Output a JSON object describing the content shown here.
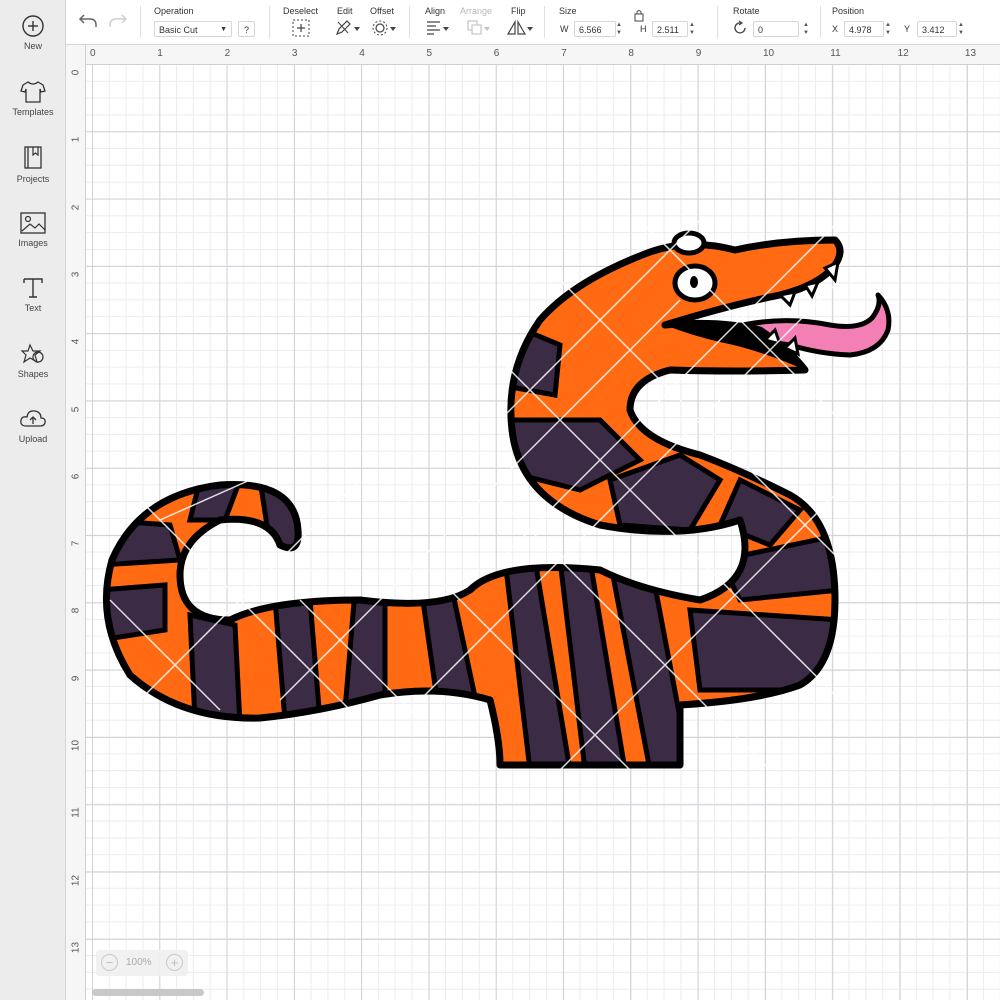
{
  "sidebar": {
    "items": [
      {
        "label": "New",
        "icon": "plus-circle-icon"
      },
      {
        "label": "Templates",
        "icon": "shirt-icon"
      },
      {
        "label": "Projects",
        "icon": "book-icon"
      },
      {
        "label": "Images",
        "icon": "image-icon"
      },
      {
        "label": "Text",
        "icon": "text-icon"
      },
      {
        "label": "Shapes",
        "icon": "shapes-icon"
      },
      {
        "label": "Upload",
        "icon": "upload-cloud-icon"
      }
    ]
  },
  "toolbar": {
    "operation_label": "Operation",
    "operation_value": "Basic Cut",
    "help_label": "?",
    "deselect_label": "Deselect",
    "edit_label": "Edit",
    "offset_label": "Offset",
    "align_label": "Align",
    "arrange_label": "Arrange",
    "flip_label": "Flip",
    "size_label": "Size",
    "width_prefix": "W",
    "width_value": "6.566",
    "height_prefix": "H",
    "height_value": "2.511",
    "rotate_label": "Rotate",
    "rotate_value": "0",
    "position_label": "Position",
    "x_prefix": "X",
    "x_value": "4.978",
    "y_prefix": "Y",
    "y_value": "3.412"
  },
  "ruler": {
    "top": [
      "0",
      "1",
      "2",
      "3",
      "4",
      "5",
      "6",
      "7",
      "8",
      "9",
      "10",
      "11",
      "12",
      "13"
    ],
    "left": [
      "0",
      "1",
      "2",
      "3",
      "4",
      "5",
      "6",
      "7",
      "8",
      "9",
      "10",
      "11",
      "12",
      "13"
    ]
  },
  "zoom": {
    "minus": "−",
    "value": "100%",
    "plus": "+"
  },
  "colors": {
    "snake_orange": "#ff6a13",
    "snake_purple": "#3b2b45",
    "tongue_pink": "#f47fb4",
    "outline": "#000000"
  }
}
